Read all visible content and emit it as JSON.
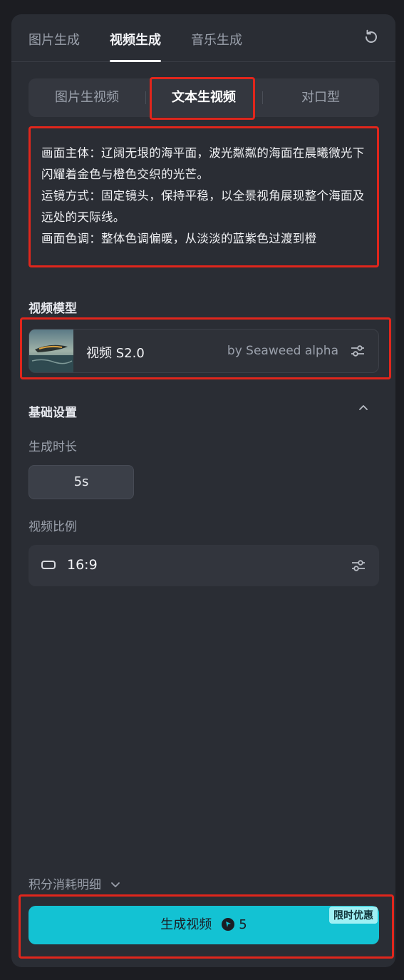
{
  "top_tabs": [
    "图片生成",
    "视频生成",
    "音乐生成"
  ],
  "sub_tabs": [
    "图片生视频",
    "文本生视频",
    "对口型"
  ],
  "prompt": {
    "text": "画面主体：辽阔无垠的海平面，波光粼粼的海面在晨曦微光下闪耀着金色与橙色交织的光芒。\n运镜方式：固定镜头，保持平稳，以全景视角展现整个海面及远处的天际线。\n画面色调：整体色调偏暖，从淡淡的蓝紫色过渡到橙"
  },
  "model_section": {
    "title": "视频模型",
    "model_name": "视频 S2.0",
    "model_by": "by Seaweed alpha"
  },
  "basic_settings": {
    "title": "基础设置",
    "duration_label": "生成时长",
    "duration_value": "5s",
    "ratio_label": "视频比例",
    "ratio_value": "16:9"
  },
  "footer": {
    "cost_label": "积分消耗明细",
    "generate_label": "生成视频",
    "credits": "5",
    "promo_badge": "限时优惠"
  },
  "colors": {
    "accent": "#13c2d3",
    "highlight_box": "#e0261c",
    "panel_bg": "#2a2d34"
  }
}
